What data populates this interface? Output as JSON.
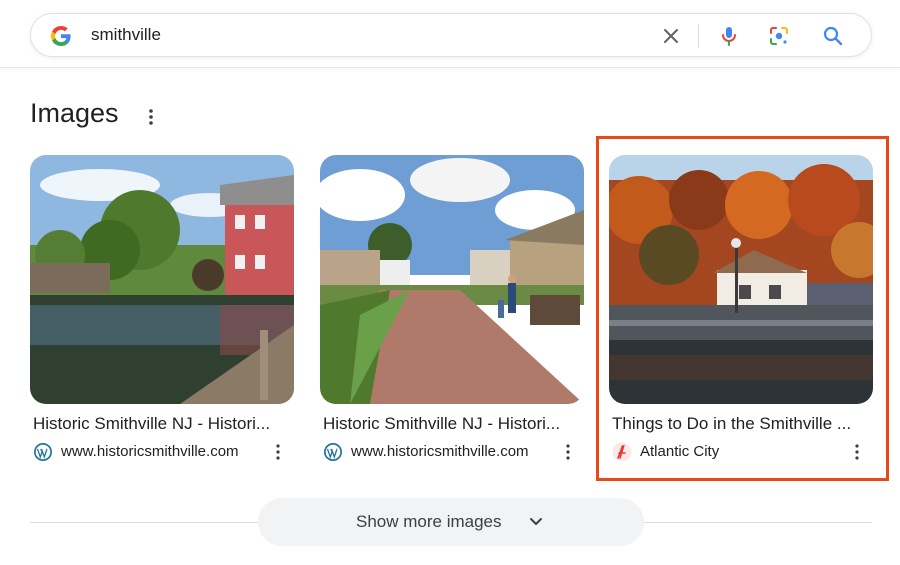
{
  "search": {
    "query": "smithville"
  },
  "section": {
    "title": "Images"
  },
  "cards": [
    {
      "caption": "Historic Smithville NJ - Histori...",
      "source": "www.historicsmithville.com",
      "source_icon": "wordpress-icon"
    },
    {
      "caption": "Historic Smithville NJ - Histori...",
      "source": "www.historicsmithville.com",
      "source_icon": "wordpress-icon"
    },
    {
      "caption": "Things to Do in the Smithville ...",
      "source": "Atlantic City",
      "source_icon": "atlantic-city-logo-icon"
    }
  ],
  "show_more": {
    "label": "Show more images"
  },
  "colors": {
    "highlight": "#e64a19",
    "google_blue": "#4285f4"
  }
}
